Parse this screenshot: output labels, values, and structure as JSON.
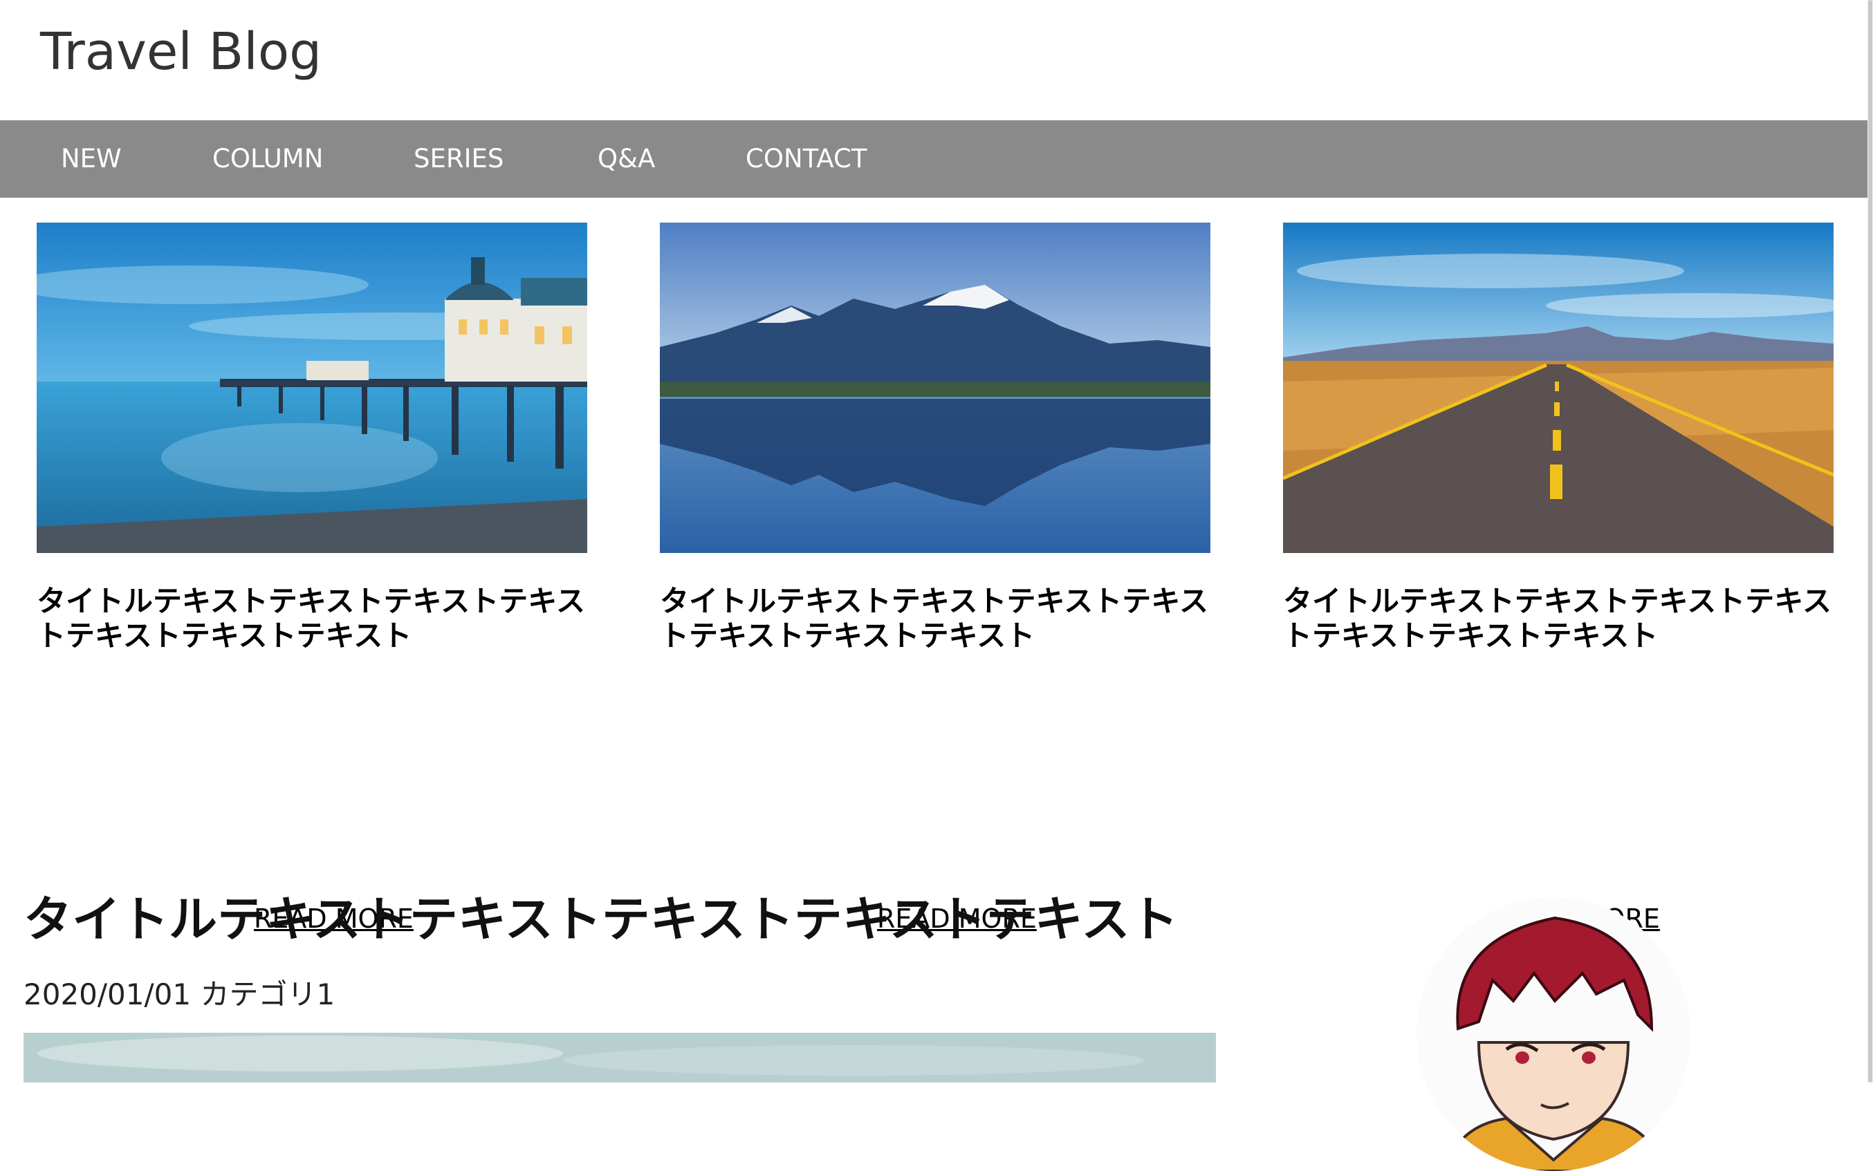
{
  "header": {
    "site_title": "Travel Blog"
  },
  "nav": {
    "items": [
      "NEW",
      "COLUMN",
      "SERIES",
      "Q&A",
      "CONTACT"
    ]
  },
  "cards": [
    {
      "title": "タイトルテキストテキストテキストテキストテキストテキストテキスト",
      "read_more": "READ MORE",
      "image": "pier-at-dusk-photo"
    },
    {
      "title": "タイトルテキストテキストテキストテキストテキストテキストテキスト",
      "read_more": "READ MORE",
      "image": "mountain-lake-reflection-photo"
    },
    {
      "title": "タイトルテキストテキストテキストテキストテキストテキストテキスト",
      "read_more": "READ MORE",
      "image": "desert-road-photo"
    }
  ],
  "post": {
    "title": "タイトルテキストテキストテキストテキストテキスト",
    "date": "2020/01/01",
    "category": "カテゴリ1"
  },
  "colors": {
    "nav_bg": "#8a8a8a",
    "nav_text": "#ffffff",
    "link": "#000000"
  }
}
